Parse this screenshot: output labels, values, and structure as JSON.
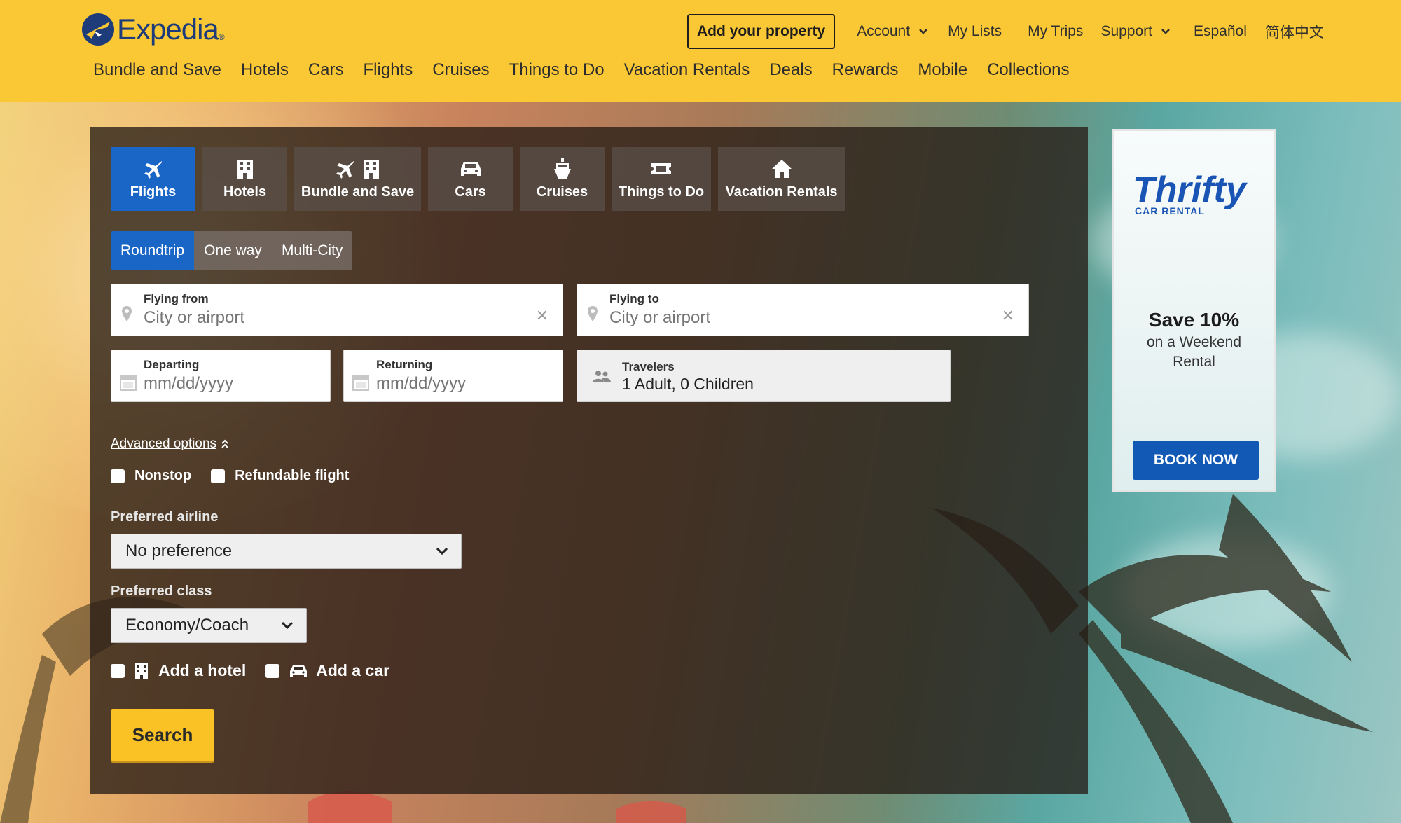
{
  "header": {
    "logo_text": "Expedia",
    "add_property": "Add your property",
    "utility_links": [
      "Account",
      "My Lists",
      "My Trips",
      "Support",
      "Español",
      "简体中文"
    ],
    "nav": [
      "Bundle and Save",
      "Hotels",
      "Cars",
      "Flights",
      "Cruises",
      "Things to Do",
      "Vacation Rentals",
      "Deals",
      "Rewards",
      "Mobile",
      "Collections"
    ]
  },
  "search": {
    "tabs": [
      {
        "label": "Flights",
        "icon": "plane-icon",
        "active": true
      },
      {
        "label": "Hotels",
        "icon": "hotel-icon"
      },
      {
        "label": "Bundle and Save",
        "icon": "plane-hotel-icon"
      },
      {
        "label": "Cars",
        "icon": "car-icon"
      },
      {
        "label": "Cruises",
        "icon": "ship-icon"
      },
      {
        "label": "Things to Do",
        "icon": "ticket-icon"
      },
      {
        "label": "Vacation Rentals",
        "icon": "house-icon"
      }
    ],
    "trip_types": [
      "Roundtrip",
      "One way",
      "Multi-City"
    ],
    "flying_from": {
      "label": "Flying from",
      "placeholder": "City or airport"
    },
    "flying_to": {
      "label": "Flying to",
      "placeholder": "City or airport"
    },
    "departing": {
      "label": "Departing",
      "placeholder": "mm/dd/yyyy"
    },
    "returning": {
      "label": "Returning",
      "placeholder": "mm/dd/yyyy"
    },
    "travelers": {
      "label": "Travelers",
      "value": "1 Adult, 0 Children"
    },
    "advanced_options": "Advanced options",
    "nonstop": "Nonstop",
    "refundable": "Refundable flight",
    "preferred_airline_label": "Preferred airline",
    "preferred_airline_value": "No preference",
    "preferred_class_label": "Preferred class",
    "preferred_class_value": "Economy/Coach",
    "add_hotel": "Add a hotel",
    "add_car": "Add a car",
    "search_button": "Search"
  },
  "ad": {
    "brand": "Thrifty",
    "brand_sub": "CAR RENTAL",
    "headline": "Save 10%",
    "line1": "on a Weekend",
    "line2": "Rental",
    "cta": "BOOK NOW"
  },
  "colors": {
    "header_bg": "#fbc835",
    "brand_blue": "#1e3c79",
    "active_tab": "#1a66c6",
    "search_button": "#fbc226",
    "ad_button": "#1258b5"
  }
}
